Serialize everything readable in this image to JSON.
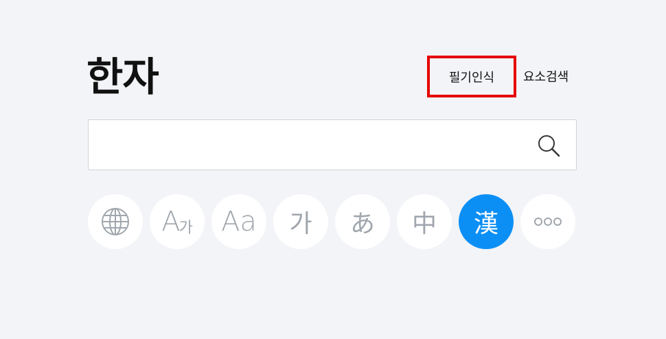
{
  "header": {
    "title": "한자",
    "handwriting_label": "필기인식",
    "element_search_label": "요소검색"
  },
  "search": {
    "value": "",
    "placeholder": ""
  },
  "categories": [
    {
      "id": "all",
      "icon": "globe-icon"
    },
    {
      "id": "korean-word",
      "label_main": "A",
      "label_sub": "가"
    },
    {
      "id": "english",
      "label": "Aa"
    },
    {
      "id": "korean",
      "label": "가"
    },
    {
      "id": "japanese",
      "label": "あ"
    },
    {
      "id": "chinese",
      "label": "中"
    },
    {
      "id": "hanja",
      "label": "漢",
      "active": true
    },
    {
      "id": "more",
      "icon": "more-icon"
    }
  ],
  "colors": {
    "active": "#0c8ff5",
    "highlight_border": "#e60000",
    "icon_gray": "#a0a6ad"
  }
}
